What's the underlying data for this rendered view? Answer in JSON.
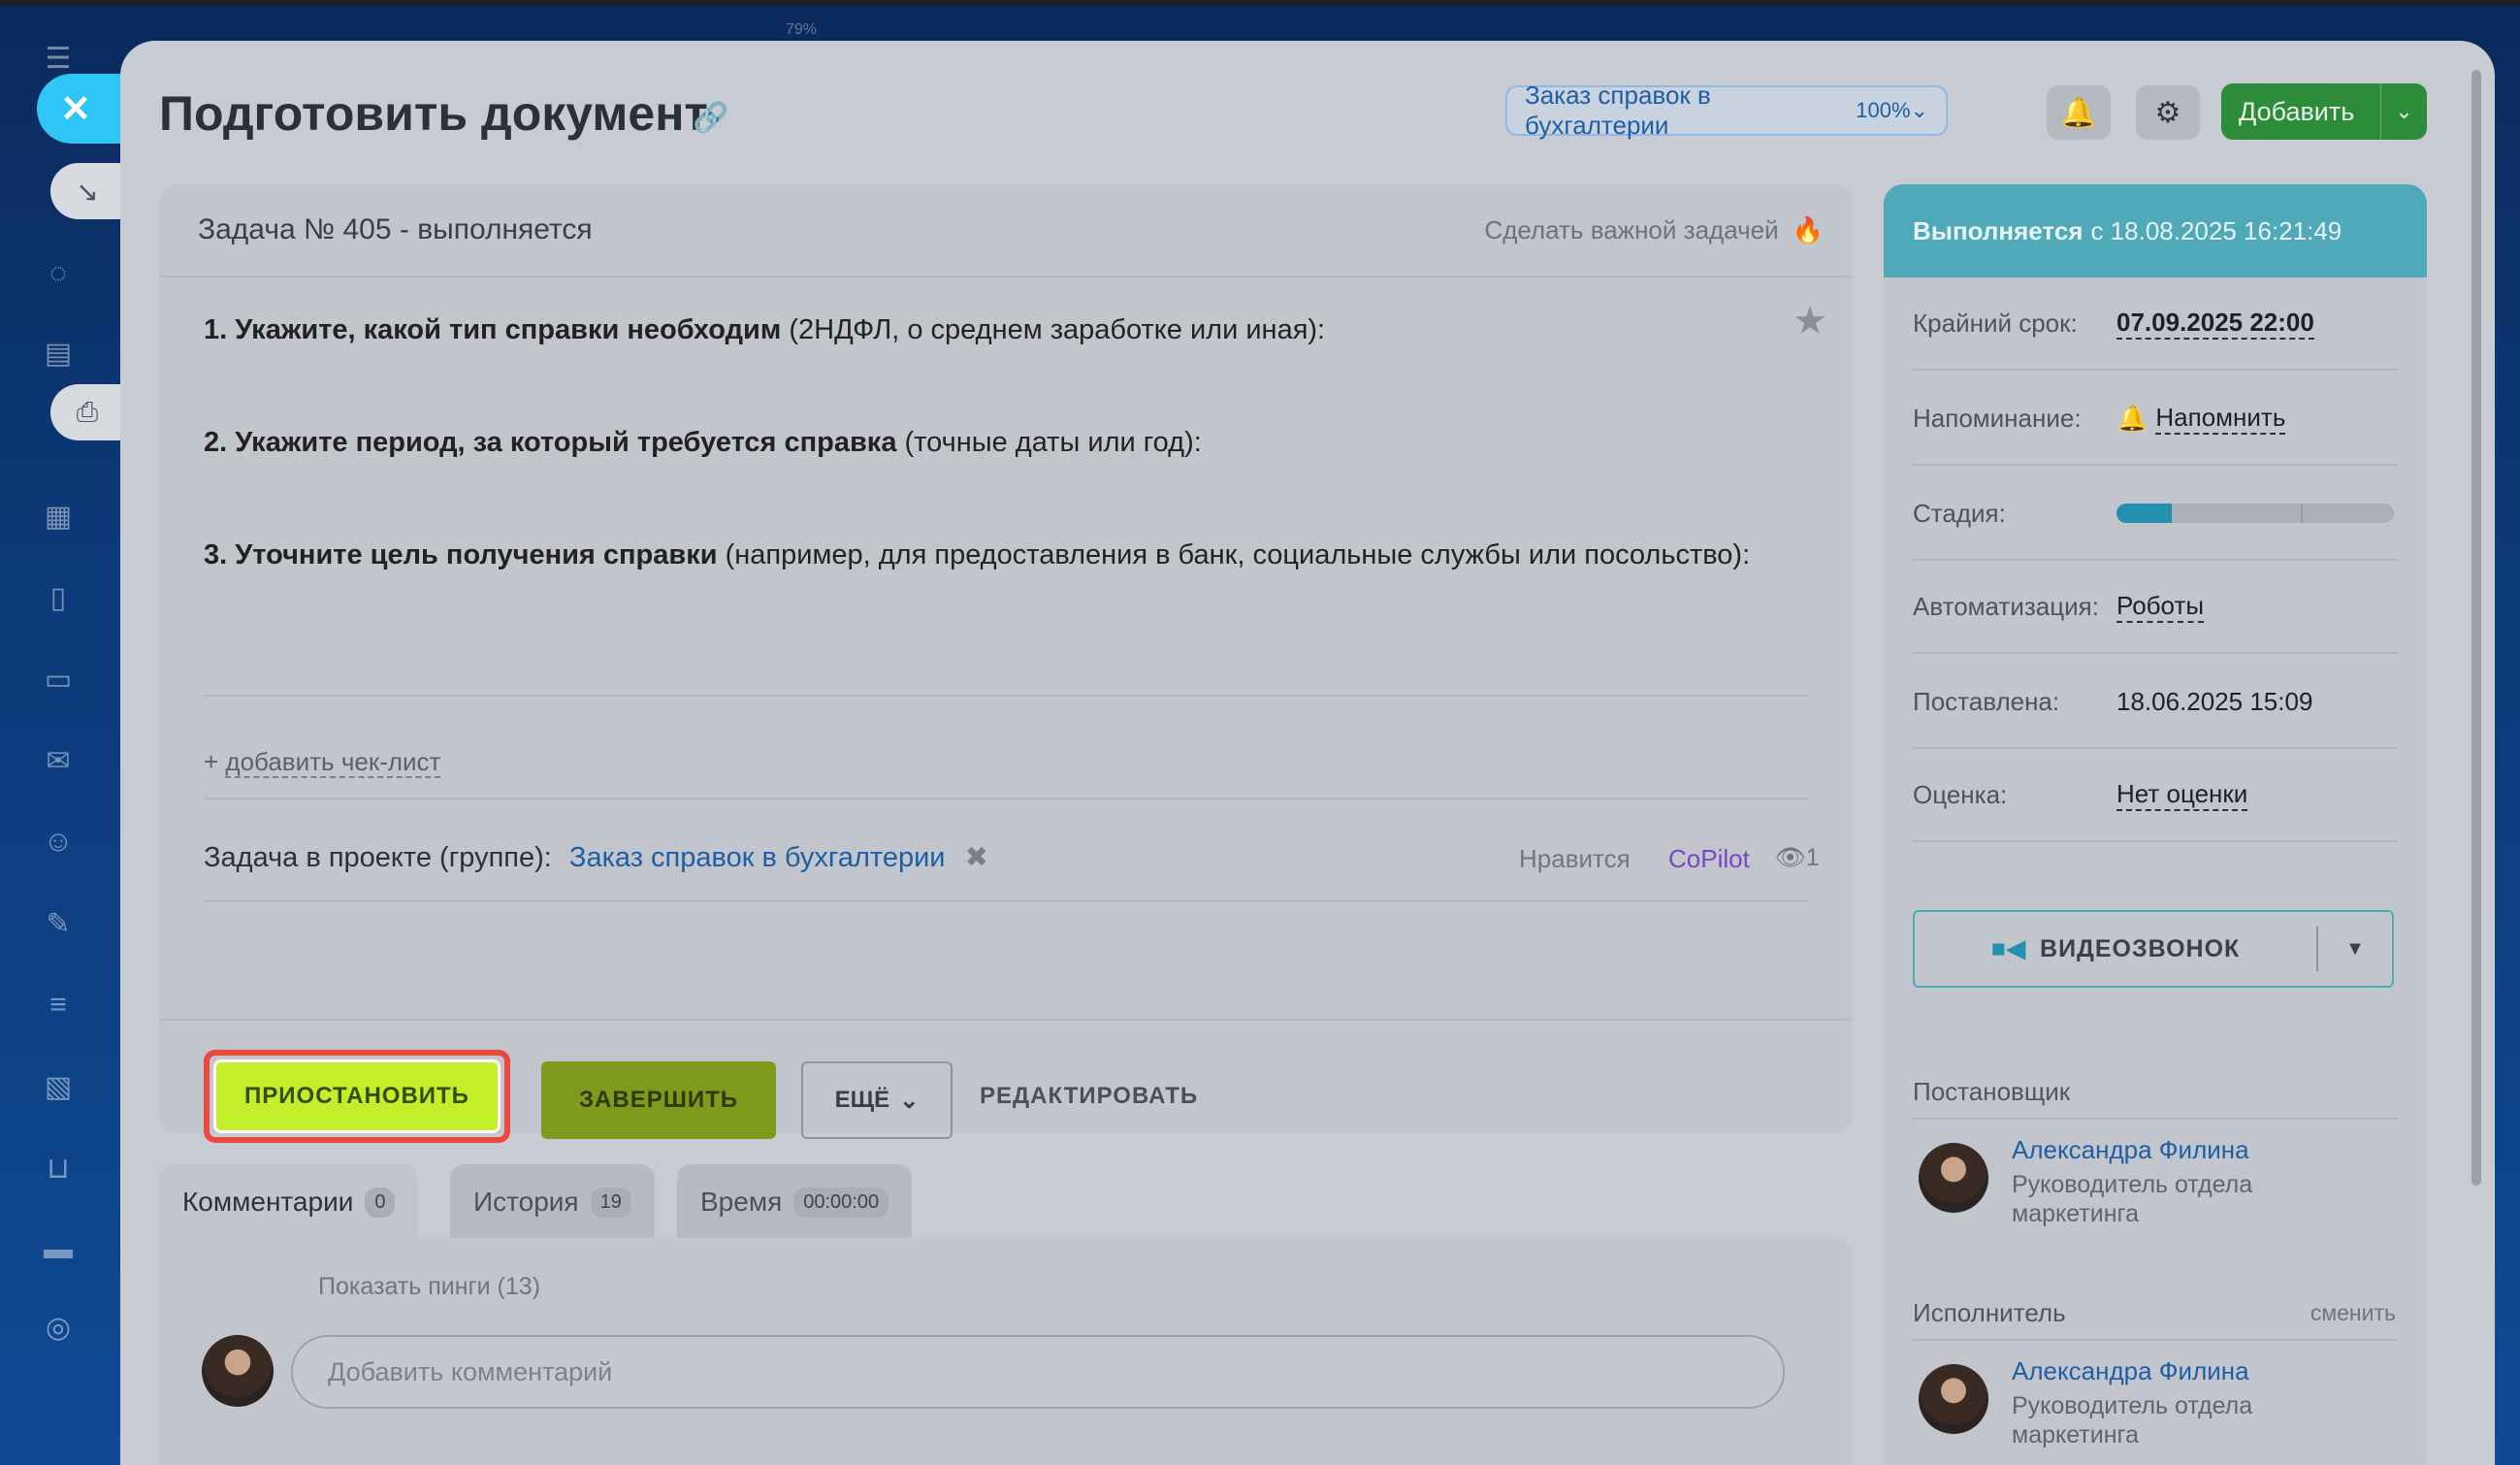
{
  "browser": {
    "zoom": "79%"
  },
  "task": {
    "title": "Подготовить документ",
    "project_chip": {
      "label": "Заказ справок в бухгалтерии",
      "percent": "100%"
    },
    "add_button": "Добавить",
    "number_status": "Задача № 405 - выполняется",
    "make_important": "Сделать важной задачей",
    "description": [
      {
        "bold": "1. Укажите, какой тип справки необходим",
        "rest": " (2НДФЛ, о среднем заработке или иная):"
      },
      {
        "bold": "2. Укажите период, за который требуется справка",
        "rest": " (точные даты или год):"
      },
      {
        "bold": "3. Уточните цель получения справки",
        "rest": " (например, для предоставления в банк, социальные службы или посольство):"
      }
    ],
    "add_checklist": "добавить чек-лист",
    "add_checklist_prefix": "+ ",
    "project_label": "Задача в проекте (группе):",
    "project_link": "Заказ справок в бухгалтерии",
    "likes": "Нравится",
    "copilot": "CoPilot",
    "views": "1",
    "actions": {
      "pause": "ПРИОСТАНОВИТЬ",
      "finish": "ЗАВЕРШИТЬ",
      "more": "ЕЩЁ",
      "edit": "РЕДАКТИРОВАТЬ"
    },
    "tabs": [
      {
        "label": "Комментарии",
        "count": "0"
      },
      {
        "label": "История",
        "count": "19"
      },
      {
        "label": "Время",
        "count": "00:00:00"
      }
    ],
    "show_pings": "Показать пинги (13)",
    "comment_placeholder": "Добавить комментарий"
  },
  "info": {
    "status_bold": "Выполняется",
    "status_rest": "с 18.08.2025 16:21:49",
    "rows": {
      "deadline": {
        "label": "Крайний срок:",
        "value": "07.09.2025 22:00"
      },
      "reminder": {
        "label": "Напоминание:",
        "value": "Напомнить"
      },
      "stage": {
        "label": "Стадия:",
        "fill": 0.2
      },
      "automation": {
        "label": "Автоматизация:",
        "value": "Роботы"
      },
      "created": {
        "label": "Поставлена:",
        "value": "18.06.2025 15:09"
      },
      "rating": {
        "label": "Оценка:",
        "value": "Нет оценки"
      }
    },
    "video_call": "ВИДЕОЗВОНОК",
    "creator_label": "Постановщик",
    "creator": {
      "name": "Александра Филина",
      "position": "Руководитель отдела маркетинга"
    },
    "assignee_label": "Исполнитель",
    "change": "сменить",
    "assignee": {
      "name": "Александра Филина",
      "position": "Руководитель отдела маркетинга"
    }
  },
  "colors": {
    "accent_pause": "#c2ee2a",
    "highlight": "#e84a3e",
    "status": "#4fa9b8",
    "link": "#1e5fa4"
  }
}
